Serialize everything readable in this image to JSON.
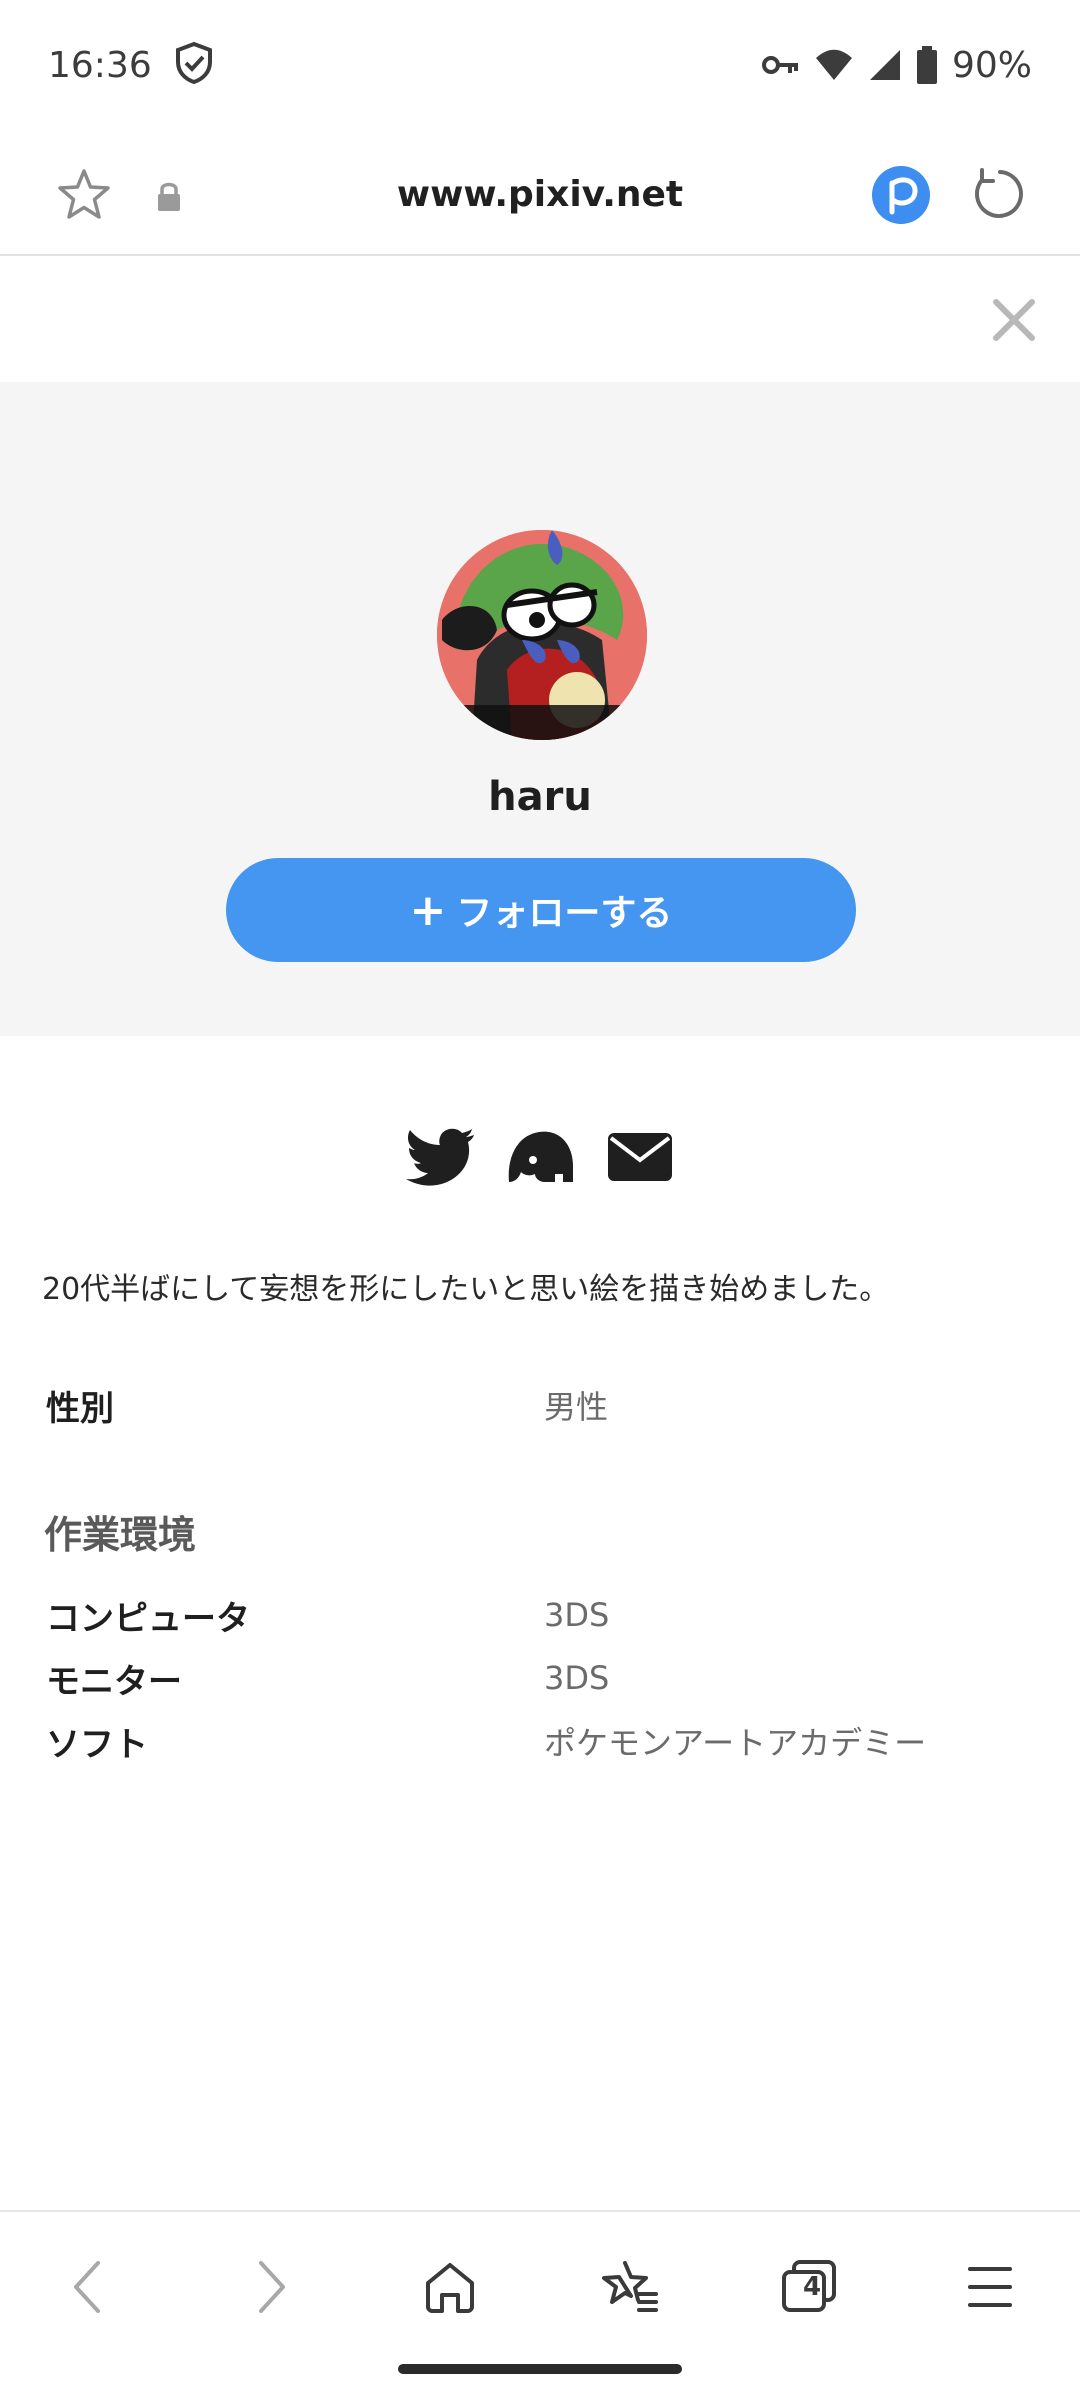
{
  "status_bar": {
    "time": "16:36",
    "battery": "90%",
    "icons": [
      "shield-icon",
      "key-icon",
      "wifi-icon",
      "signal-icon",
      "battery-icon"
    ]
  },
  "browser": {
    "url": "www.pixiv.net",
    "icons": [
      "star-icon",
      "lock-icon",
      "pixiv-icon",
      "reload-icon"
    ]
  },
  "profile": {
    "username": "haru",
    "follow_label": "フォローする",
    "follow_plus": "+",
    "avatar_bg": "#e8726a",
    "social_icons": [
      "twitter-icon",
      "mastodon-icon",
      "mail-icon"
    ],
    "bio": "20代半ばにして妄想を形にしたいと思い絵を描き始めました。",
    "gender_key": "性別",
    "gender_val": "男性",
    "workspace_title": "作業環境",
    "workspace": [
      {
        "key": "コンピュータ",
        "val": "3DS"
      },
      {
        "key": "モニター",
        "val": "3DS"
      },
      {
        "key": "ソフト",
        "val": "ポケモンアートアカデミー"
      }
    ]
  },
  "colors": {
    "accent": "#4496f1",
    "header_bg": "#f5f5f5"
  },
  "nav": {
    "tab_count": "4",
    "icons": [
      "back-icon",
      "forward-icon",
      "home-icon",
      "bookmarks-icon",
      "tabs-icon",
      "menu-icon"
    ]
  }
}
